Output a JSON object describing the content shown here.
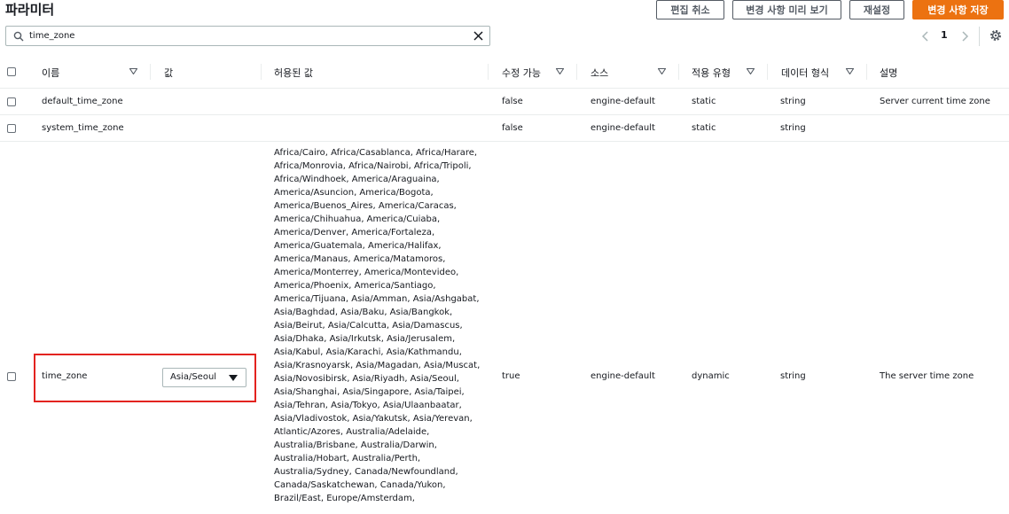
{
  "page": {
    "title": "파라미터"
  },
  "toolbar": {
    "cancel_label": "편집 취소",
    "preview_label": "변경 사항 미리 보기",
    "reset_label": "재설정",
    "save_label": "변경 사항 저장"
  },
  "search": {
    "value": "time_zone"
  },
  "pagination": {
    "current_page": "1"
  },
  "table": {
    "columns": {
      "name": "이름",
      "value": "값",
      "allowed": "허용된 값",
      "modifiable": "수정 가능",
      "source": "소스",
      "apply_type": "적용 유형",
      "data_type": "데이터 형식",
      "description": "설명"
    },
    "rows": [
      {
        "name": "default_time_zone",
        "value": "",
        "allowed": "",
        "modifiable": "false",
        "source": "engine-default",
        "apply_type": "static",
        "data_type": "string",
        "description": "Server current time zone"
      },
      {
        "name": "system_time_zone",
        "value": "",
        "allowed": "",
        "modifiable": "false",
        "source": "engine-default",
        "apply_type": "static",
        "data_type": "string",
        "description": ""
      },
      {
        "name": "time_zone",
        "value": "Asia/Seoul",
        "allowed": "Africa/Cairo, Africa/Casablanca, Africa/Harare,\nAfrica/Monrovia, Africa/Nairobi, Africa/Tripoli,\nAfrica/Windhoek, America/Araguaina,\nAmerica/Asuncion, America/Bogota,\nAmerica/Buenos_Aires, America/Caracas,\nAmerica/Chihuahua, America/Cuiaba,\nAmerica/Denver, America/Fortaleza,\nAmerica/Guatemala, America/Halifax,\nAmerica/Manaus, America/Matamoros,\nAmerica/Monterrey, America/Montevideo,\nAmerica/Phoenix, America/Santiago,\nAmerica/Tijuana, Asia/Amman, Asia/Ashgabat,\nAsia/Baghdad, Asia/Baku, Asia/Bangkok,\nAsia/Beirut, Asia/Calcutta, Asia/Damascus,\nAsia/Dhaka, Asia/Irkutsk, Asia/Jerusalem,\nAsia/Kabul, Asia/Karachi, Asia/Kathmandu,\nAsia/Krasnoyarsk, Asia/Magadan, Asia/Muscat,\nAsia/Novosibirsk, Asia/Riyadh, Asia/Seoul,\nAsia/Shanghai, Asia/Singapore, Asia/Taipei,\nAsia/Tehran, Asia/Tokyo, Asia/Ulaanbaatar,\nAsia/Vladivostok, Asia/Yakutsk, Asia/Yerevan,\nAtlantic/Azores, Australia/Adelaide,\nAustralia/Brisbane, Australia/Darwin,\nAustralia/Hobart, Australia/Perth,\nAustralia/Sydney, Canada/Newfoundland,\nCanada/Saskatchewan, Canada/Yukon,\nBrazil/East, Europe/Amsterdam,",
        "modifiable": "true",
        "source": "engine-default",
        "apply_type": "dynamic",
        "data_type": "string",
        "description": "The server time zone"
      }
    ]
  },
  "colors": {
    "primary": "#ec7211",
    "highlight": "#e3231f"
  },
  "icons": [
    "search-icon",
    "clear-icon",
    "chevron-left-icon",
    "chevron-right-icon",
    "settings-icon",
    "sort-caret-icon",
    "dropdown-arrow-icon"
  ]
}
